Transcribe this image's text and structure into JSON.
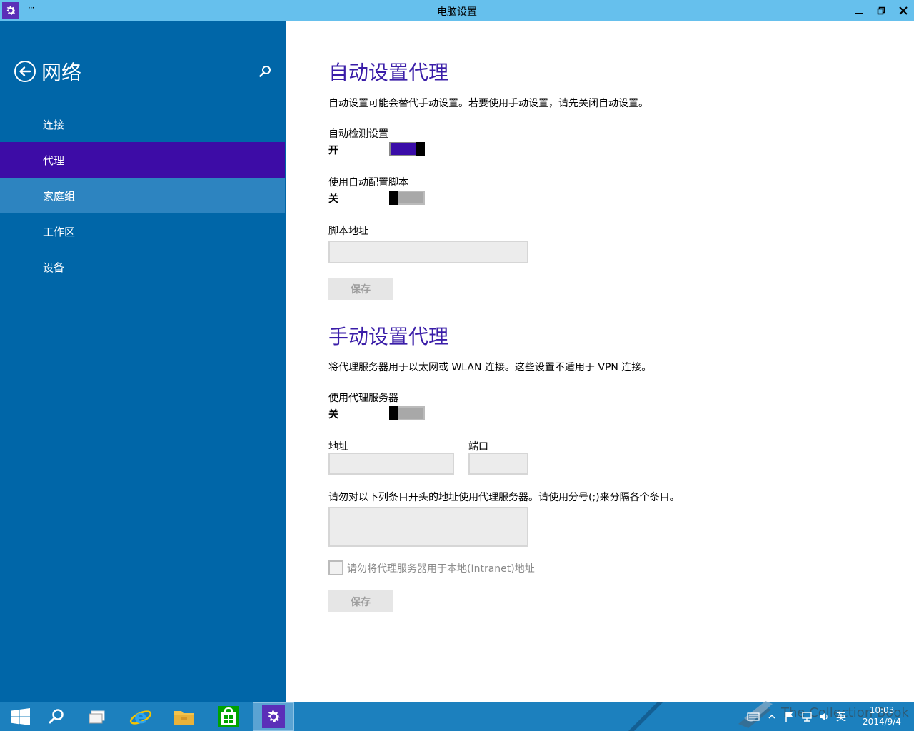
{
  "window": {
    "title": "电脑设置",
    "more": "···"
  },
  "sidebar": {
    "title": "网络",
    "items": [
      {
        "label": "连接"
      },
      {
        "label": "代理"
      },
      {
        "label": "家庭组"
      },
      {
        "label": "工作区"
      },
      {
        "label": "设备"
      }
    ]
  },
  "auto_proxy": {
    "heading": "自动设置代理",
    "description": "自动设置可能会替代手动设置。若要使用手动设置，请先关闭自动设置。",
    "detect_label": "自动检测设置",
    "detect_state": "开",
    "script_label": "使用自动配置脚本",
    "script_state": "关",
    "address_label": "脚本地址",
    "address_value": "",
    "save_label": "保存"
  },
  "manual_proxy": {
    "heading": "手动设置代理",
    "description": "将代理服务器用于以太网或 WLAN 连接。这些设置不适用于 VPN 连接。",
    "use_label": "使用代理服务器",
    "use_state": "关",
    "address_label": "地址",
    "address_value": "",
    "port_label": "端口",
    "port_value": "",
    "exceptions_label": "请勿对以下列条目开头的地址使用代理服务器。请使用分号(;)来分隔各个条目。",
    "exceptions_value": "",
    "local_checkbox_label": "请勿将代理服务器用于本地(Intranet)地址",
    "local_checkbox_checked": false,
    "save_label": "保存"
  },
  "taskbar": {
    "ime": "英",
    "time": "10:03",
    "date": "2014/9/4",
    "watermark": "The Collection Book"
  },
  "colors": {
    "titlebar": "#66c0ed",
    "sidebar": "#0066a8",
    "selected": "#3d0ca6",
    "accent": "#3a1da8",
    "taskbar": "#1c80be"
  }
}
